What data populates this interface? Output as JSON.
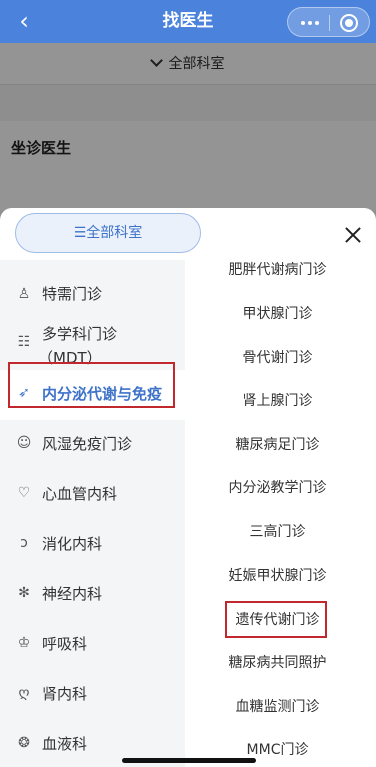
{
  "header": {
    "title": "找医生"
  },
  "filter": {
    "label": "全部科室"
  },
  "doctors": {
    "heading": "坐诊医生"
  },
  "sheet": {
    "all_button": "☰全部科室",
    "categories": [
      {
        "label": "特需门诊",
        "icon": "person-icon"
      },
      {
        "label": "多学科门诊",
        "label2": "（MDT）",
        "icon": "team-icon"
      },
      {
        "label": "内分泌代谢与免疫",
        "icon": "rocket-icon"
      },
      {
        "label": "风湿免疫门诊",
        "icon": "face-icon"
      },
      {
        "label": "心血管内科",
        "icon": "heart-icon"
      },
      {
        "label": "消化内科",
        "icon": "stomach-icon"
      },
      {
        "label": "神经内科",
        "icon": "neuron-icon"
      },
      {
        "label": "呼吸科",
        "icon": "lungs-icon"
      },
      {
        "label": "肾内科",
        "icon": "kidney-icon"
      },
      {
        "label": "血液科",
        "icon": "blood-icon"
      }
    ],
    "active_category": "内分泌代谢与免疫",
    "subdepartments": [
      "肥胖代谢病门诊",
      "甲状腺门诊",
      "骨代谢门诊",
      "肾上腺门诊",
      "糖尿病足门诊",
      "内分泌教学门诊",
      "三高门诊",
      "妊娠甲状腺门诊",
      "遗传代谢门诊",
      "糖尿病共同照护",
      "血糖监测门诊",
      "MMC门诊"
    ]
  },
  "colors": {
    "header": "#4b82dc",
    "accent": "#3e73c9",
    "highlight_box": "#c0282d"
  }
}
